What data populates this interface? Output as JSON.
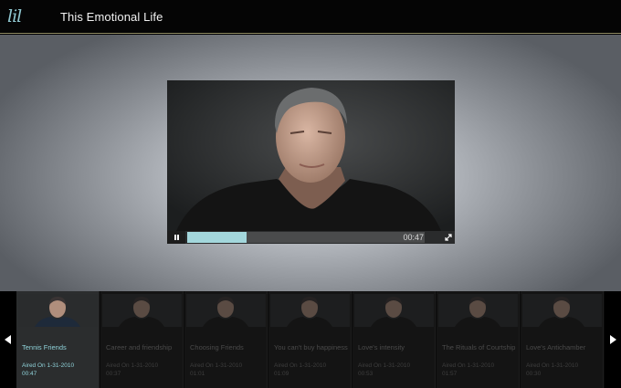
{
  "header": {
    "logo_text": "lil",
    "title": "This Emotional Life"
  },
  "player": {
    "time": "00:47",
    "progress_fraction": 0.25,
    "pause_icon": "pause-icon",
    "fullscreen_icon": "fullscreen-icon"
  },
  "strip": {
    "prev_icon": "arrow-left-icon",
    "next_icon": "arrow-right-icon",
    "items": [
      {
        "title": "Tennis Friends",
        "aired": "Aired On 1-31-2010",
        "duration": "00:47",
        "active": true
      },
      {
        "title": "Career and friendship",
        "aired": "Aired On 1-31-2010",
        "duration": "00:37",
        "active": false
      },
      {
        "title": "Choosing Friends",
        "aired": "Aired On 1-31-2010",
        "duration": "01:01",
        "active": false
      },
      {
        "title": "You can't buy happiness",
        "aired": "Aired On 1-31-2010",
        "duration": "01:09",
        "active": false
      },
      {
        "title": "Love's intensity",
        "aired": "Aired On 1-31-2010",
        "duration": "00:53",
        "active": false
      },
      {
        "title": "The Rituals of Courtship",
        "aired": "Aired On 1-31-2010",
        "duration": "01:57",
        "active": false
      },
      {
        "title": "Love's Antichamber",
        "aired": "Aired On 1-31-2010",
        "duration": "00:30",
        "active": false
      }
    ]
  },
  "colors": {
    "accent": "#a3d7dc",
    "header_rule": "#8e8a63",
    "background": "#000000"
  }
}
